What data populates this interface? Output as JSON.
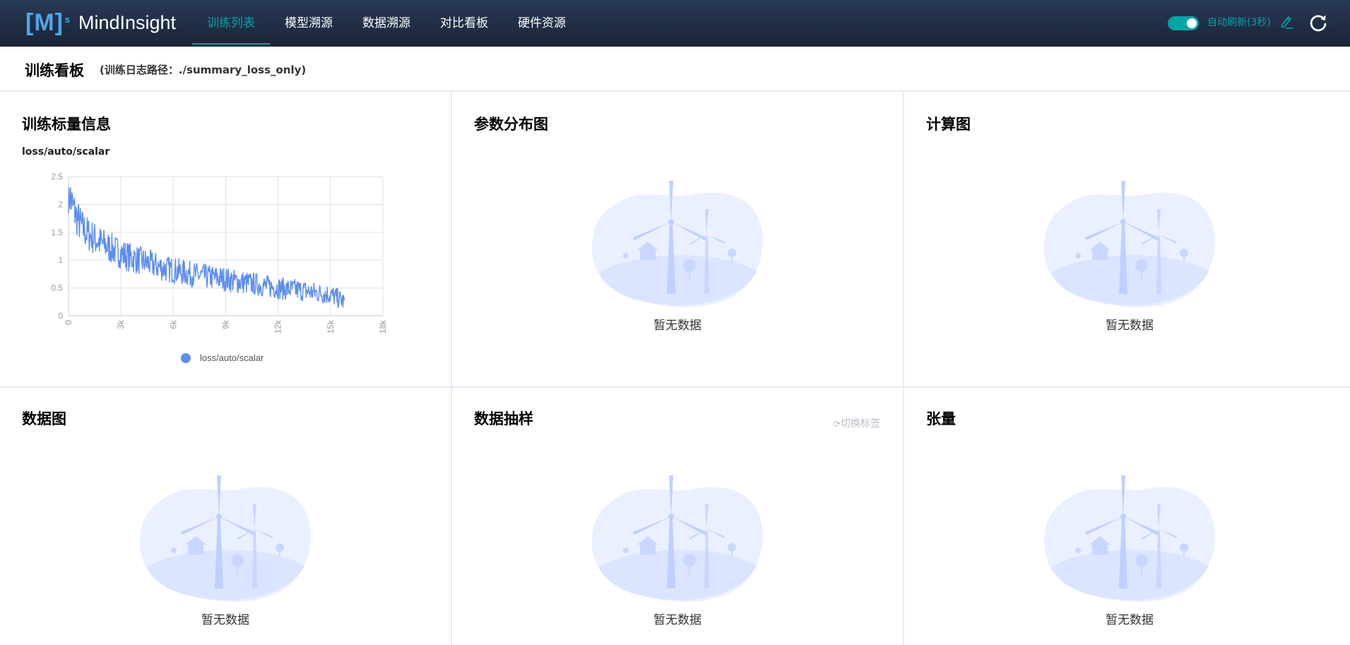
{
  "app": {
    "logo": "[M]",
    "logo_sup": "s",
    "name": "MindInsight"
  },
  "nav": {
    "items": [
      "训练列表",
      "模型溯源",
      "数据溯源",
      "对比看板",
      "硬件资源"
    ],
    "active_index": 0
  },
  "header": {
    "auto_refresh_enabled": true,
    "auto_refresh_label": "自动刷新(3秒)",
    "accent_color": "#00a5a7"
  },
  "page": {
    "title": "训练看板",
    "log_path": "(训练日志路径：./summary_loss_only)"
  },
  "cards": {
    "scalar": {
      "title": "训练标量信息",
      "tag": "loss/auto/scalar"
    },
    "histogram": {
      "title": "参数分布图",
      "empty_text": "暂无数据"
    },
    "graph": {
      "title": "计算图",
      "empty_text": "暂无数据"
    },
    "dataset_graph": {
      "title": "数据图",
      "empty_text": "暂无数据"
    },
    "image_sample": {
      "title": "数据抽样",
      "switch_label": "切换标签",
      "empty_text": "暂无数据"
    },
    "tensor": {
      "title": "张量",
      "empty_text": "暂无数据"
    }
  },
  "chart_data": {
    "type": "line",
    "title": "loss/auto/scalar",
    "xlim": [
      0,
      18000
    ],
    "ylim": [
      0,
      2.5
    ],
    "x_ticks": [
      "0",
      "3k",
      "6k",
      "9k",
      "12k",
      "15k",
      "18k"
    ],
    "y_ticks": [
      "0",
      "0.5",
      "1",
      "1.5",
      "2",
      "2.5"
    ],
    "grid": true,
    "legend_position": "bottom",
    "series": [
      {
        "name": "loss/auto/scalar",
        "color": "#5d8df0",
        "x": [
          0,
          250,
          500,
          750,
          1000,
          1500,
          2000,
          2500,
          3000,
          3500,
          4000,
          4500,
          5000,
          5500,
          6000,
          6500,
          7000,
          7500,
          8000,
          8500,
          9000,
          9500,
          10000,
          10500,
          11000,
          11500,
          12000,
          12500,
          13000,
          13500,
          14000,
          14500,
          15000,
          15500,
          15800
        ],
        "y": [
          2.25,
          1.95,
          1.75,
          1.6,
          1.5,
          1.38,
          1.28,
          1.2,
          1.12,
          1.05,
          1.0,
          0.95,
          0.9,
          0.85,
          0.82,
          0.78,
          0.75,
          0.72,
          0.7,
          0.68,
          0.66,
          0.62,
          0.6,
          0.58,
          0.55,
          0.52,
          0.5,
          0.48,
          0.47,
          0.45,
          0.42,
          0.4,
          0.38,
          0.3,
          0.25
        ]
      }
    ]
  }
}
